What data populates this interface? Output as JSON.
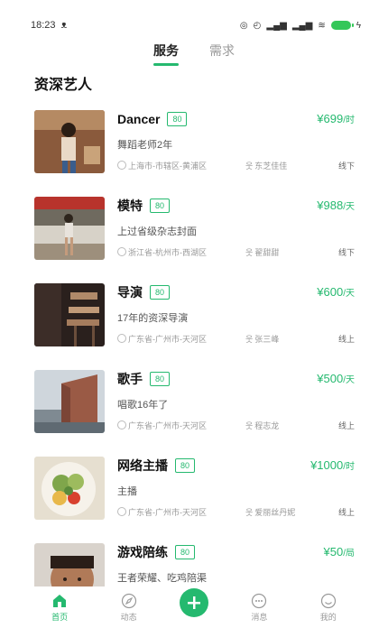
{
  "status_bar": {
    "time": "18:23",
    "left_extra": "ᴥ"
  },
  "tabs": [
    {
      "label": "服务",
      "active": true
    },
    {
      "label": "需求",
      "active": false
    }
  ],
  "section_title": "资深艺人",
  "items": [
    {
      "name": "Dancer",
      "badge": "80",
      "price": "¥699",
      "unit": "/时",
      "desc": "舞蹈老师2年",
      "location": "上海市-市辖区-黄浦区",
      "person": "东芝佳佳",
      "mode": "线下"
    },
    {
      "name": "模特",
      "badge": "80",
      "price": "¥988",
      "unit": "/天",
      "desc": "上过省级杂志封面",
      "location": "浙江省-杭州市-西湖区",
      "person": "翟甜甜",
      "mode": "线下"
    },
    {
      "name": "导演",
      "badge": "80",
      "price": "¥600",
      "unit": "/天",
      "desc": "17年的资深导演",
      "location": "广东省-广州市-天河区",
      "person": "张三峰",
      "mode": "线上"
    },
    {
      "name": "歌手",
      "badge": "80",
      "price": "¥500",
      "unit": "/天",
      "desc": "唱歌16年了",
      "location": "广东省-广州市-天河区",
      "person": "程志龙",
      "mode": "线上"
    },
    {
      "name": "网络主播",
      "badge": "80",
      "price": "¥1000",
      "unit": "/时",
      "desc": "主播",
      "location": "广东省-广州市-天河区",
      "person": "爱丽丝丹妮",
      "mode": "线上"
    },
    {
      "name": "游戏陪练",
      "badge": "80",
      "price": "¥50",
      "unit": "/局",
      "desc": "王者荣耀、吃鸡陪渠",
      "location": "",
      "person": "",
      "mode": ""
    }
  ],
  "nav": [
    {
      "label": "首页",
      "icon": "home-icon",
      "active": true
    },
    {
      "label": "动态",
      "icon": "compass-icon",
      "active": false
    },
    {
      "label": "",
      "icon": "plus-icon",
      "active": false
    },
    {
      "label": "消息",
      "icon": "chat-icon",
      "active": false
    },
    {
      "label": "我的",
      "icon": "smiley-icon",
      "active": false
    }
  ],
  "colors": {
    "accent": "#25b96f"
  }
}
